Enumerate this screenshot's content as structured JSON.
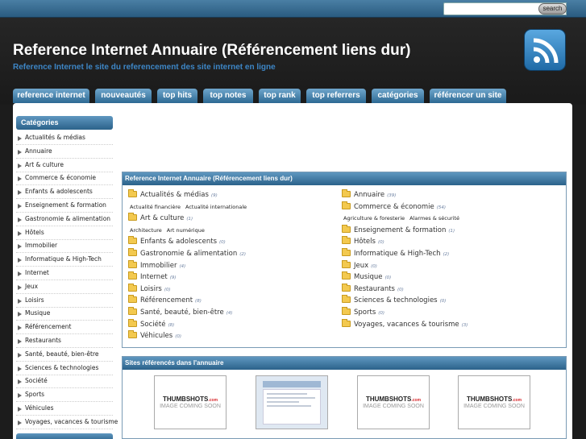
{
  "search": {
    "placeholder": "",
    "button_label": "search"
  },
  "header": {
    "title": "Reference Internet Annuaire (Référencement liens dur)",
    "subtitle": "Reference Internet le site du referencement des site internet en ligne"
  },
  "tabs": [
    "reference internet",
    "nouveautés",
    "top hits",
    "top notes",
    "top rank",
    "top referrers",
    "catégories",
    "référencer un site"
  ],
  "sidebar": {
    "title": "Catégories",
    "items": [
      "Actualités & médias",
      "Annuaire",
      "Art & culture",
      "Commerce & économie",
      "Enfants & adolescents",
      "Enseignement & formation",
      "Gastronomie & alimentation",
      "Hôtels",
      "Immobilier",
      "Informatique & High-Tech",
      "Internet",
      "Jeux",
      "Loisirs",
      "Musique",
      "Référencement",
      "Restaurants",
      "Santé, beauté, bien-être",
      "Sciences & technologies",
      "Société",
      "Sports",
      "Véhicules",
      "Voyages, vacances & tourisme"
    ]
  },
  "directory": {
    "title": "Reference Internet Annuaire (Référencement liens dur)",
    "left": [
      {
        "name": "Actualités & médias",
        "count": "(9)",
        "subs": [
          "Actualité financière",
          "Actualité internationale"
        ]
      },
      {
        "name": "Art & culture",
        "count": "(1)",
        "subs": [
          "Architecture",
          "Art numérique"
        ]
      },
      {
        "name": "Enfants & adolescents",
        "count": "(0)"
      },
      {
        "name": "Gastronomie & alimentation",
        "count": "(2)"
      },
      {
        "name": "Immobilier",
        "count": "(4)"
      },
      {
        "name": "Internet",
        "count": "(9)"
      },
      {
        "name": "Loisirs",
        "count": "(0)"
      },
      {
        "name": "Référencement",
        "count": "(8)"
      },
      {
        "name": "Santé, beauté, bien-être",
        "count": "(4)"
      },
      {
        "name": "Société",
        "count": "(8)"
      },
      {
        "name": "Véhicules",
        "count": "(0)"
      }
    ],
    "right": [
      {
        "name": "Annuaire",
        "count": "(39)"
      },
      {
        "name": "Commerce & économie",
        "count": "(54)",
        "subs": [
          "Agriculture & foresterie",
          "Alarmes & sécurité"
        ]
      },
      {
        "name": "Enseignement & formation",
        "count": "(1)"
      },
      {
        "name": "Hôtels",
        "count": "(0)"
      },
      {
        "name": "Informatique & High-Tech",
        "count": "(2)"
      },
      {
        "name": "Jeux",
        "count": "(0)"
      },
      {
        "name": "Musique",
        "count": "(0)"
      },
      {
        "name": "Restaurants",
        "count": "(0)"
      },
      {
        "name": "Sciences & technologies",
        "count": "(0)"
      },
      {
        "name": "Sports",
        "count": "(0)"
      },
      {
        "name": "Voyages, vacances & tourisme",
        "count": "(3)"
      }
    ]
  },
  "sites": {
    "title": "Sites référencés dans l'annuaire",
    "thumb_brand": "THUMBSHOTS",
    "thumb_brand_suffix": ".com",
    "thumb_text": "IMAGE COMING SOON",
    "thumbs": [
      "placeholder",
      "screenshot",
      "placeholder",
      "placeholder"
    ]
  },
  "colors": {
    "accent": "#2b628a",
    "link": "#3d86c6",
    "background": "#1c1c1c"
  },
  "icons": {
    "rss": "rss-feed-icon",
    "folder": "folder-icon",
    "arrow": "arrow-right-icon"
  }
}
